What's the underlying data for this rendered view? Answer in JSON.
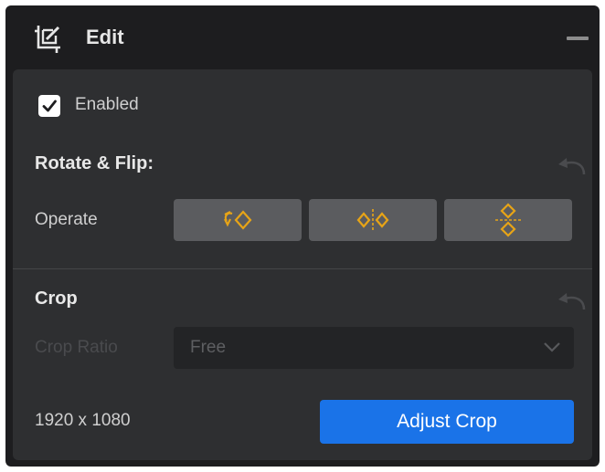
{
  "header": {
    "title": "Edit",
    "icon": "crop-edit-icon",
    "collapse_icon": "minus-icon"
  },
  "enabled": {
    "label": "Enabled",
    "checked": true
  },
  "rotate_flip": {
    "title": "Rotate & Flip:",
    "operate_label": "Operate",
    "buttons": [
      {
        "name": "rotate-button",
        "icon": "rotate-icon"
      },
      {
        "name": "flip-horizontal-button",
        "icon": "flip-horizontal-icon"
      },
      {
        "name": "flip-vertical-button",
        "icon": "flip-vertical-icon"
      }
    ],
    "reset_icon": "undo-icon"
  },
  "crop": {
    "title": "Crop",
    "ratio_label": "Crop Ratio",
    "ratio_value": "Free",
    "resolution": "1920 x 1080",
    "adjust_label": "Adjust Crop",
    "reset_icon": "undo-icon"
  },
  "colors": {
    "panel_bg": "#1d1d1f",
    "body_bg": "#2e2f31",
    "button_bg": "#5b5c5f",
    "icon_accent": "#e7a417",
    "primary": "#1a73e8"
  }
}
